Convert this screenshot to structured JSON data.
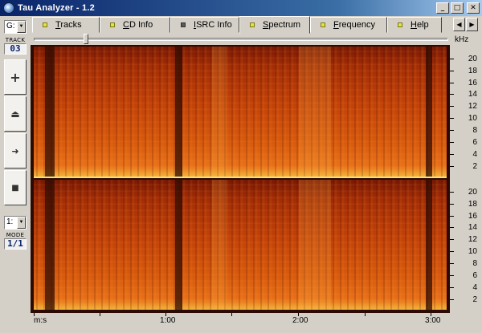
{
  "window": {
    "title": "Tau Analyzer - 1.2",
    "controls": [
      "minimize",
      "maximize",
      "close"
    ]
  },
  "sidebar": {
    "drive_value": "G:",
    "track_label": "TRACK",
    "track_number": "03",
    "buttons": [
      {
        "name": "add",
        "icon": "plus-icon",
        "glyph": "+"
      },
      {
        "name": "eject",
        "icon": "eject-icon",
        "glyph": "⏏"
      },
      {
        "name": "play",
        "icon": "play-icon",
        "glyph": "➜"
      },
      {
        "name": "stop",
        "icon": "stop-icon",
        "glyph": "■"
      }
    ],
    "mode_value": "1:",
    "mode_label": "MODE",
    "mode_number": "1/1"
  },
  "tabs": [
    {
      "label": "Tracks",
      "active": false
    },
    {
      "label": "CD Info",
      "active": false
    },
    {
      "label": "ISRC Info",
      "active": false
    },
    {
      "label": "Spectrum",
      "active": true
    },
    {
      "label": "Frequency",
      "active": false
    },
    {
      "label": "Help",
      "active": false
    }
  ],
  "nav": {
    "prev": "◀",
    "next": "▶"
  },
  "spectrogram": {
    "freq_unit": "kHz",
    "freq_labels": [
      "20",
      "18",
      "16",
      "14",
      "12",
      "10",
      "8",
      "6",
      "4",
      "2"
    ],
    "time_labels": [
      "m:s",
      "1:00",
      "2:00",
      "3:00"
    ],
    "channels": 2,
    "colors": {
      "low": "#7a1804",
      "mid": "#c24109",
      "high": "#f3b33a"
    }
  }
}
